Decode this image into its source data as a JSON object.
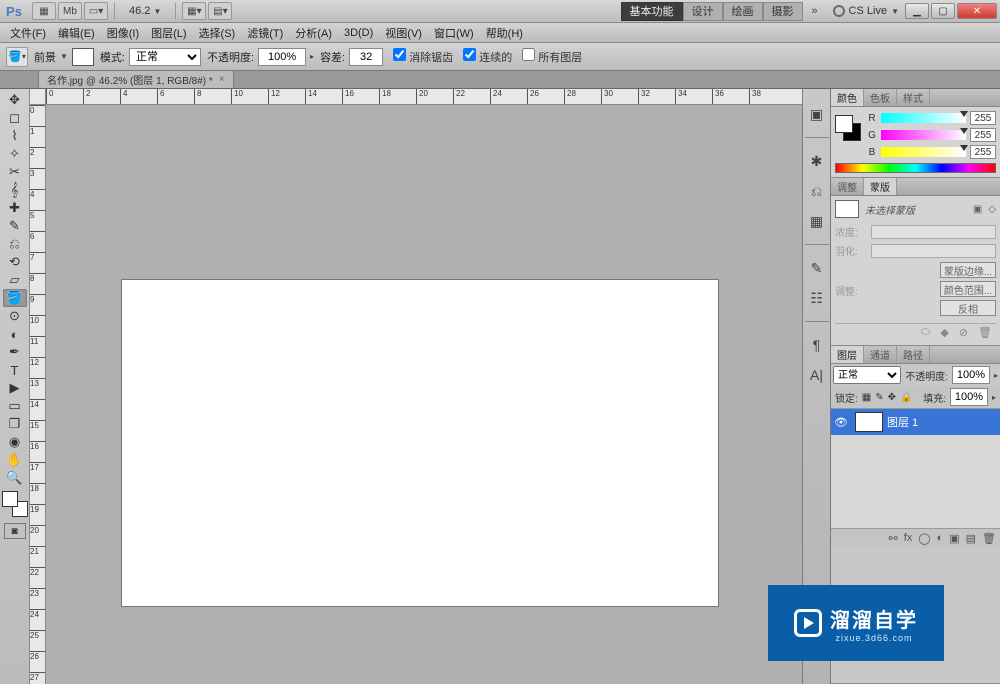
{
  "titlebar": {
    "logo": "Ps",
    "mb_label": "Mb",
    "zoom": "46.2",
    "workspaces": [
      "基本功能",
      "设计",
      "绘画",
      "摄影"
    ],
    "workspaces_more": "»",
    "cslive": "CS Live"
  },
  "menu": [
    "文件(F)",
    "编辑(E)",
    "图像(I)",
    "图层(L)",
    "选择(S)",
    "滤镜(T)",
    "分析(A)",
    "3D(D)",
    "视图(V)",
    "窗口(W)",
    "帮助(H)"
  ],
  "options": {
    "fg_label": "前景",
    "mode_label": "模式:",
    "mode_value": "正常",
    "opacity_label": "不透明度:",
    "opacity_value": "100%",
    "tolerance_label": "容差:",
    "tolerance_value": "32",
    "antialias": "消除锯齿",
    "contiguous": "连续的",
    "all_layers": "所有图层"
  },
  "document": {
    "tab": "名作.jpg @ 46.2% (图层 1, RGB/8#) *"
  },
  "ruler_h": [
    0,
    2,
    4,
    6,
    8,
    10,
    12,
    14,
    16,
    18,
    20,
    22,
    24,
    26,
    28,
    30,
    32,
    34,
    36,
    38
  ],
  "ruler_v": [
    0,
    1,
    2,
    3,
    4,
    5,
    6,
    7,
    8,
    9,
    10,
    11,
    12,
    13,
    14,
    15,
    16,
    17,
    18,
    19,
    20,
    21,
    22,
    23,
    24,
    25,
    26,
    27
  ],
  "panels": {
    "color": {
      "tabs": [
        "颜色",
        "色板",
        "样式"
      ],
      "r": {
        "label": "R",
        "value": "255"
      },
      "g": {
        "label": "G",
        "value": "255"
      },
      "b": {
        "label": "B",
        "value": "255"
      }
    },
    "mask": {
      "tabs": [
        "调整",
        "蒙版"
      ],
      "no_sel": "未选择蒙版",
      "density": "浓度:",
      "feather": "羽化:",
      "refine": "调整:",
      "btn_edge": "蒙版边缘...",
      "btn_color": "颜色范围...",
      "btn_invert": "反相"
    },
    "layers": {
      "tabs": [
        "图层",
        "通道",
        "路径"
      ],
      "blend": "正常",
      "opacity_label": "不透明度:",
      "opacity_value": "100%",
      "lock_label": "锁定:",
      "fill_label": "填充:",
      "fill_value": "100%",
      "layer_name": "图层 1"
    }
  },
  "watermark": {
    "cn": "溜溜自学",
    "en": "zixue.3d66.com"
  }
}
